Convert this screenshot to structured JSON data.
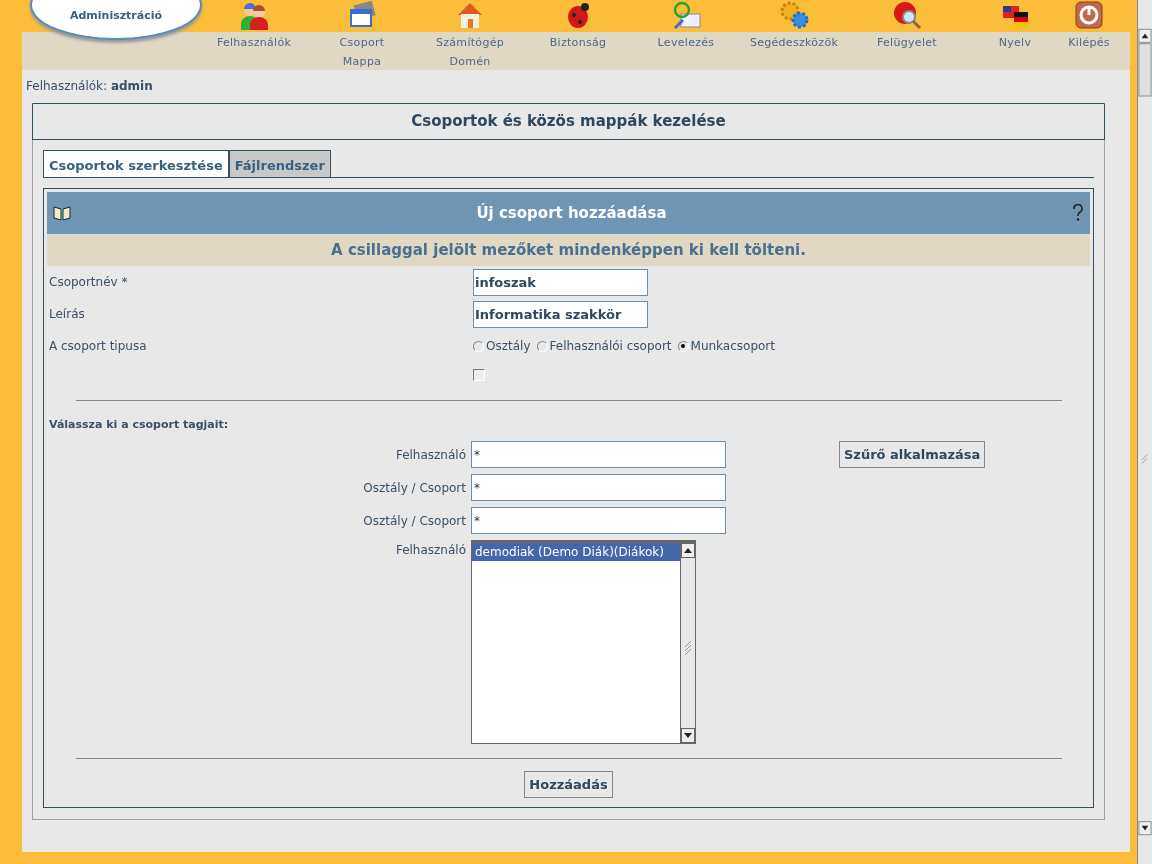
{
  "logo": {
    "subtitle": "Adminisztráció"
  },
  "nav": [
    {
      "kind": "users",
      "label": [
        "Felhasználók"
      ]
    },
    {
      "kind": "window",
      "label": [
        "Csoport",
        "Mappa"
      ]
    },
    {
      "kind": "house",
      "label": [
        "Számítógép",
        "Domén"
      ]
    },
    {
      "kind": "bug",
      "label": [
        "Biztonság"
      ]
    },
    {
      "kind": "mail",
      "label": [
        "Levelezés"
      ]
    },
    {
      "kind": "gears",
      "label": [
        "Segédeszközök"
      ]
    },
    {
      "kind": "help",
      "label": [
        "Felügyelet"
      ]
    },
    {
      "kind": "flags",
      "label": [
        "Nyelv"
      ]
    },
    {
      "kind": "power",
      "label": [
        "Kilépés"
      ]
    }
  ],
  "breadcrumb": "Felhasználók: **admin**",
  "panel_title": "Csoportok és közös mappák kezelése",
  "tabs": [
    {
      "label": "Csoportok szerkesztése",
      "selected": true
    },
    {
      "label": "Fájlrendszer",
      "selected": false
    }
  ],
  "form": {
    "title": "Új csoport hozzáadása",
    "notice": "A csillaggal jelölt mezőket mindenképpen ki kell tölteni.",
    "fields": [
      {
        "kind": "text",
        "label": "Csoportnév *",
        "value": "infoszak"
      },
      {
        "kind": "text",
        "label": "Leírás",
        "value": "Informatika szakkör"
      },
      {
        "kind": "radio",
        "label": "A csoport tipusa",
        "options": [
          {
            "label": "Osztály",
            "selected": false
          },
          {
            "label": "Felhasználói csoport",
            "selected": false
          },
          {
            "label": "Munkacsoport",
            "selected": true
          }
        ]
      },
      {
        "kind": "checkbox",
        "checked": false
      }
    ],
    "members_heading": "Válassza ki a csoport tagjait:",
    "filters": [
      {
        "label": "Felhasználó",
        "value": "*"
      },
      {
        "label": "Osztály / Csoport",
        "value": "*"
      },
      {
        "label": "Osztály / Csoport",
        "value": "*"
      }
    ],
    "filter_button": "Szűrő alkalmazása",
    "list": {
      "label": "Felhasználó",
      "items": [
        {
          "text": "demodiak (Demo Diák)(Diákok)",
          "selected": true
        }
      ]
    },
    "submit": "Hozzáadás"
  }
}
